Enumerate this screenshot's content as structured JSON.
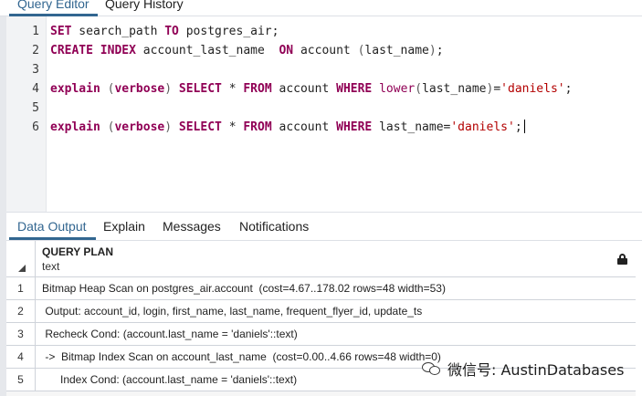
{
  "top_tabs": [
    "Query Editor",
    "Query History"
  ],
  "editor": {
    "line_numbers": [
      "1",
      "2",
      "3",
      "4",
      "5",
      "6"
    ],
    "lines": [
      [
        {
          "t": "SET",
          "c": "kw"
        },
        {
          "t": " search_path ",
          "c": ""
        },
        {
          "t": "TO",
          "c": "kw"
        },
        {
          "t": " postgres_air;",
          "c": ""
        }
      ],
      [
        {
          "t": "CREATE",
          "c": "kw"
        },
        {
          "t": " ",
          "c": ""
        },
        {
          "t": "INDEX",
          "c": "kw"
        },
        {
          "t": " account_last_name  ",
          "c": ""
        },
        {
          "t": "ON",
          "c": "kw"
        },
        {
          "t": " account ",
          "c": ""
        },
        {
          "t": "(",
          "c": "par"
        },
        {
          "t": "last_name",
          "c": ""
        },
        {
          "t": ")",
          "c": "par"
        },
        {
          "t": ";",
          "c": ""
        }
      ],
      [],
      [
        {
          "t": "explain",
          "c": "kw"
        },
        {
          "t": " ",
          "c": ""
        },
        {
          "t": "(",
          "c": "par"
        },
        {
          "t": "verbose",
          "c": "kw"
        },
        {
          "t": ")",
          "c": "par"
        },
        {
          "t": " ",
          "c": ""
        },
        {
          "t": "SELECT",
          "c": "kw"
        },
        {
          "t": " * ",
          "c": ""
        },
        {
          "t": "FROM",
          "c": "kw"
        },
        {
          "t": " account ",
          "c": ""
        },
        {
          "t": "WHERE",
          "c": "kw"
        },
        {
          "t": " ",
          "c": ""
        },
        {
          "t": "lower",
          "c": "fn"
        },
        {
          "t": "(",
          "c": "par"
        },
        {
          "t": "last_name",
          "c": ""
        },
        {
          "t": ")",
          "c": "par"
        },
        {
          "t": "=",
          "c": ""
        },
        {
          "t": "'daniels'",
          "c": "str"
        },
        {
          "t": ";",
          "c": ""
        }
      ],
      [],
      [
        {
          "t": "explain",
          "c": "kw"
        },
        {
          "t": " ",
          "c": ""
        },
        {
          "t": "(",
          "c": "par"
        },
        {
          "t": "verbose",
          "c": "kw"
        },
        {
          "t": ")",
          "c": "par"
        },
        {
          "t": " ",
          "c": ""
        },
        {
          "t": "SELECT",
          "c": "kw"
        },
        {
          "t": " * ",
          "c": ""
        },
        {
          "t": "FROM",
          "c": "kw"
        },
        {
          "t": " account ",
          "c": ""
        },
        {
          "t": "WHERE",
          "c": "kw"
        },
        {
          "t": " last_name=",
          "c": ""
        },
        {
          "t": "'daniels'",
          "c": "str"
        },
        {
          "t": ";",
          "c": ""
        }
      ]
    ]
  },
  "output_tabs": [
    "Data Output",
    "Explain",
    "Messages",
    "Notifications"
  ],
  "grid": {
    "column_name": "QUERY PLAN",
    "column_type": "text",
    "lock_icon": "lock-icon",
    "rows": [
      {
        "n": "1",
        "text": "Bitmap Heap Scan on postgres_air.account  (cost=4.67..178.02 rows=48 width=53)"
      },
      {
        "n": "2",
        "text": " Output: account_id, login, first_name, last_name, frequent_flyer_id, update_ts"
      },
      {
        "n": "3",
        "text": " Recheck Cond: (account.last_name = 'daniels'::text)"
      },
      {
        "n": "4",
        "text": " ->  Bitmap Index Scan on account_last_name  (cost=0.00..4.66 rows=48 width=0)"
      },
      {
        "n": "5",
        "text": "      Index Cond: (account.last_name = 'daniels'::text)"
      }
    ]
  },
  "watermark": {
    "icon": "wechat-icon",
    "text": "微信号: AustinDatabases"
  },
  "colors": {
    "accent": "#326690",
    "keyword": "#900055",
    "string": "#b30000"
  }
}
